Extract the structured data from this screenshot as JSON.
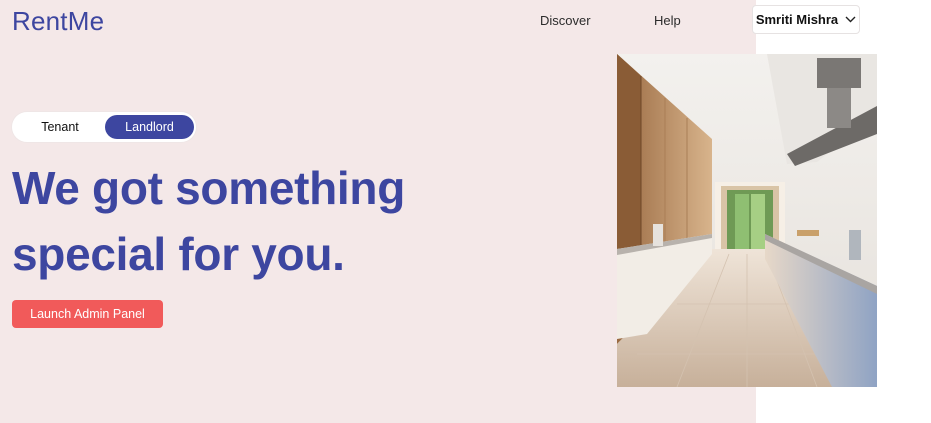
{
  "header": {
    "logo": "RentMe",
    "nav": [
      "Discover",
      "Help"
    ],
    "user_name": "Smriti Mishra"
  },
  "hero": {
    "toggle": {
      "options": [
        "Tenant",
        "Landlord"
      ],
      "selected": "Landlord"
    },
    "headline_line1": "We got something",
    "headline_line2": "special for you.",
    "cta_label": "Launch Admin Panel"
  },
  "colors": {
    "brand": "#3d46a0",
    "cta": "#f15a5a",
    "hero_background": "#f4e8e8"
  }
}
